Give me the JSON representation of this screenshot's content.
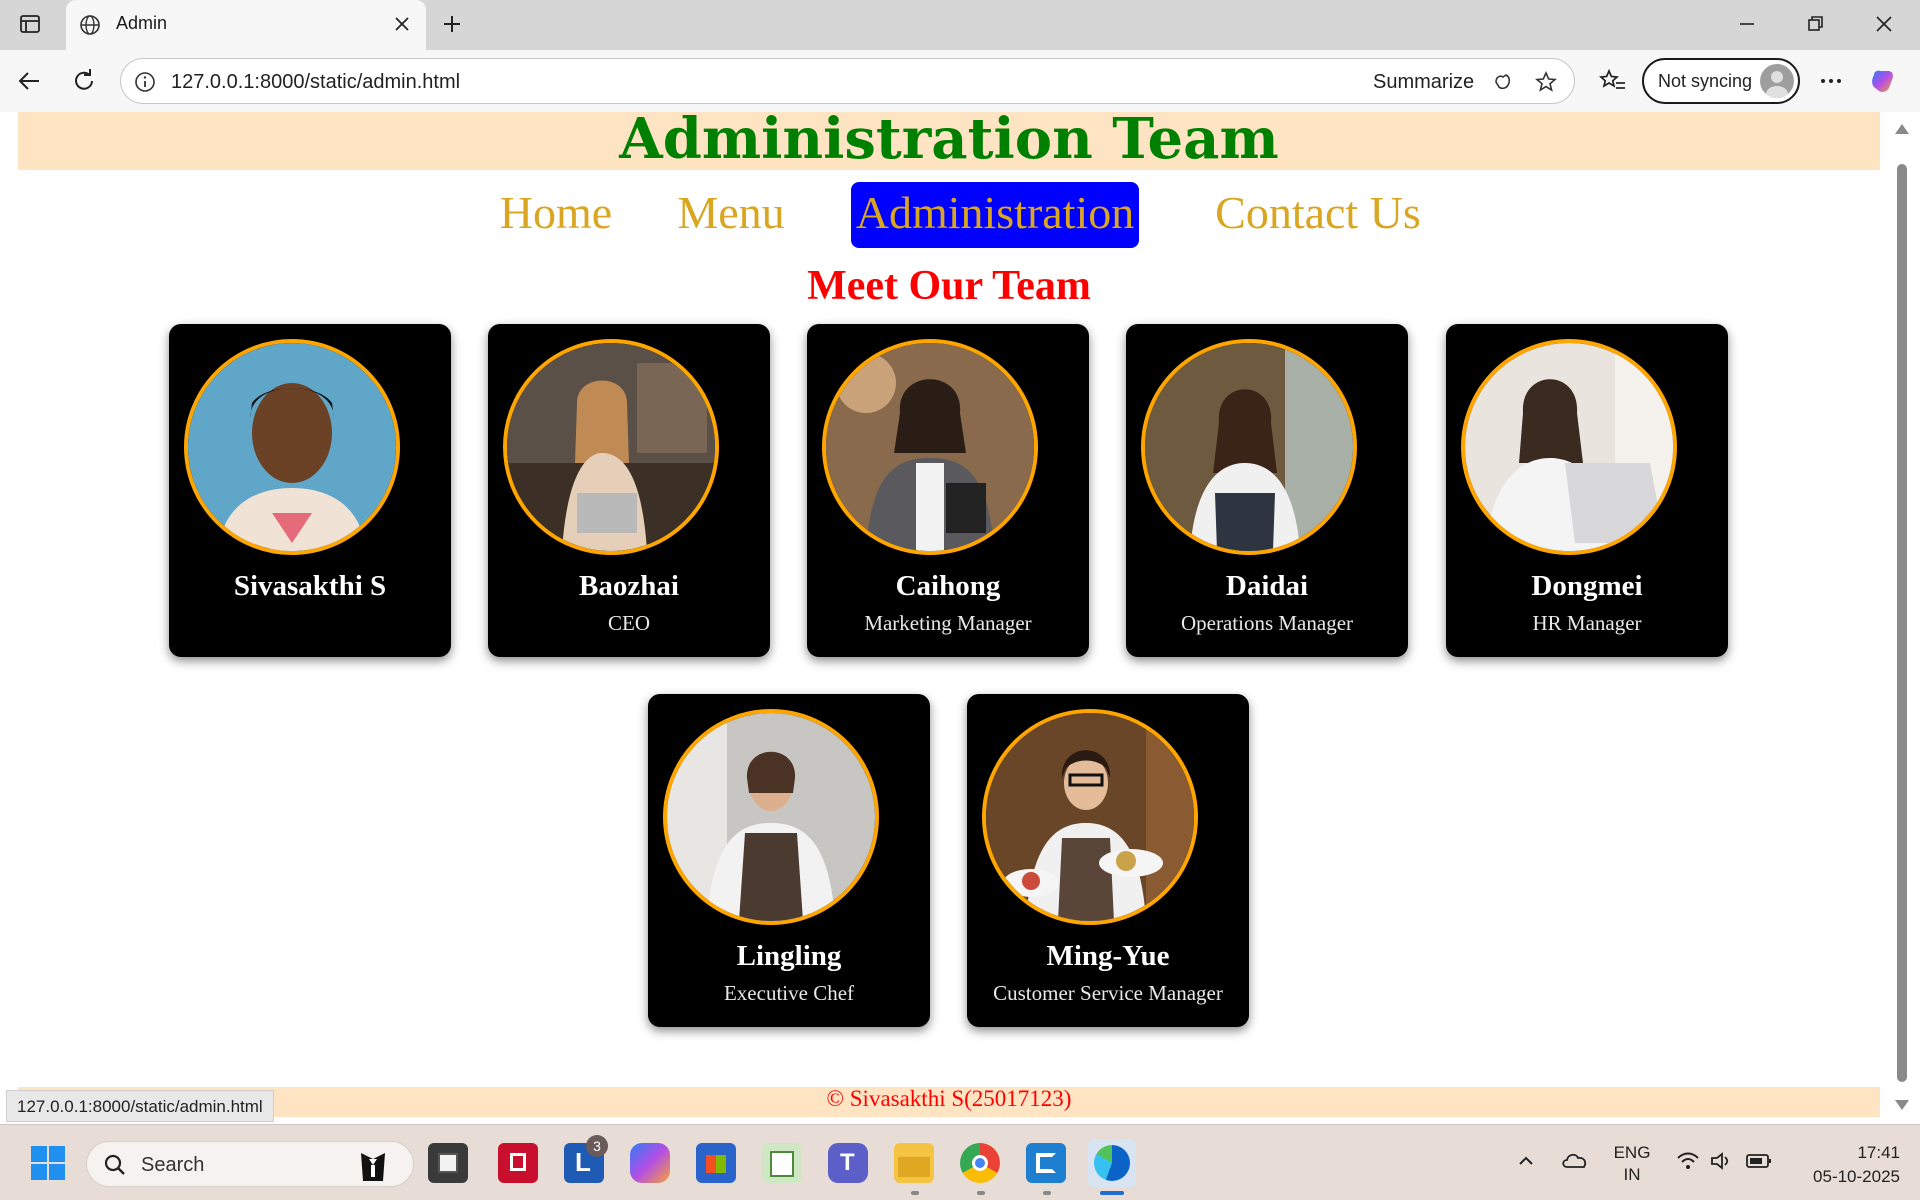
{
  "browser": {
    "tab_title": "Admin",
    "url": "127.0.0.1:8000/static/admin.html",
    "summarize_label": "Summarize",
    "sync_label": "Not syncing"
  },
  "page": {
    "header_title": "Administration Team",
    "nav": [
      {
        "label": "Home",
        "active": false
      },
      {
        "label": "Menu",
        "active": false
      },
      {
        "label": "Administration",
        "active": true
      },
      {
        "label": "Contact Us",
        "active": false
      }
    ],
    "section_title": "Meet Our Team",
    "team": [
      {
        "name": "Sivasakthi S",
        "role": "",
        "photo": "portrait-photo"
      },
      {
        "name": "Baozhai",
        "role": "CEO",
        "photo": "portrait-photo"
      },
      {
        "name": "Caihong",
        "role": "Marketing Manager",
        "photo": "portrait-photo"
      },
      {
        "name": "Daidai",
        "role": "Operations Manager",
        "photo": "portrait-photo"
      },
      {
        "name": "Dongmei",
        "role": "HR Manager",
        "photo": "portrait-photo"
      },
      {
        "name": "Lingling",
        "role": "Executive Chef",
        "photo": "portrait-photo"
      },
      {
        "name": "Ming-Yue",
        "role": "Customer Service Manager",
        "photo": "portrait-photo"
      }
    ],
    "footer": "© Sivasakthi S(25017123)",
    "status_url": "127.0.0.1:8000/static/admin.html"
  },
  "colors": {
    "header_band": "#ffe4c4",
    "header_title": "#008000",
    "nav_text": "#daa520",
    "nav_active_bg": "#0000ff",
    "section_title": "#ff0000",
    "card_bg": "#000000",
    "avatar_ring": "#ffa500"
  },
  "taskbar": {
    "search_label": "Search",
    "badge_count": "3",
    "lang_top": "ENG",
    "lang_bottom": "IN",
    "time": "17:41",
    "date": "05-10-2025"
  }
}
